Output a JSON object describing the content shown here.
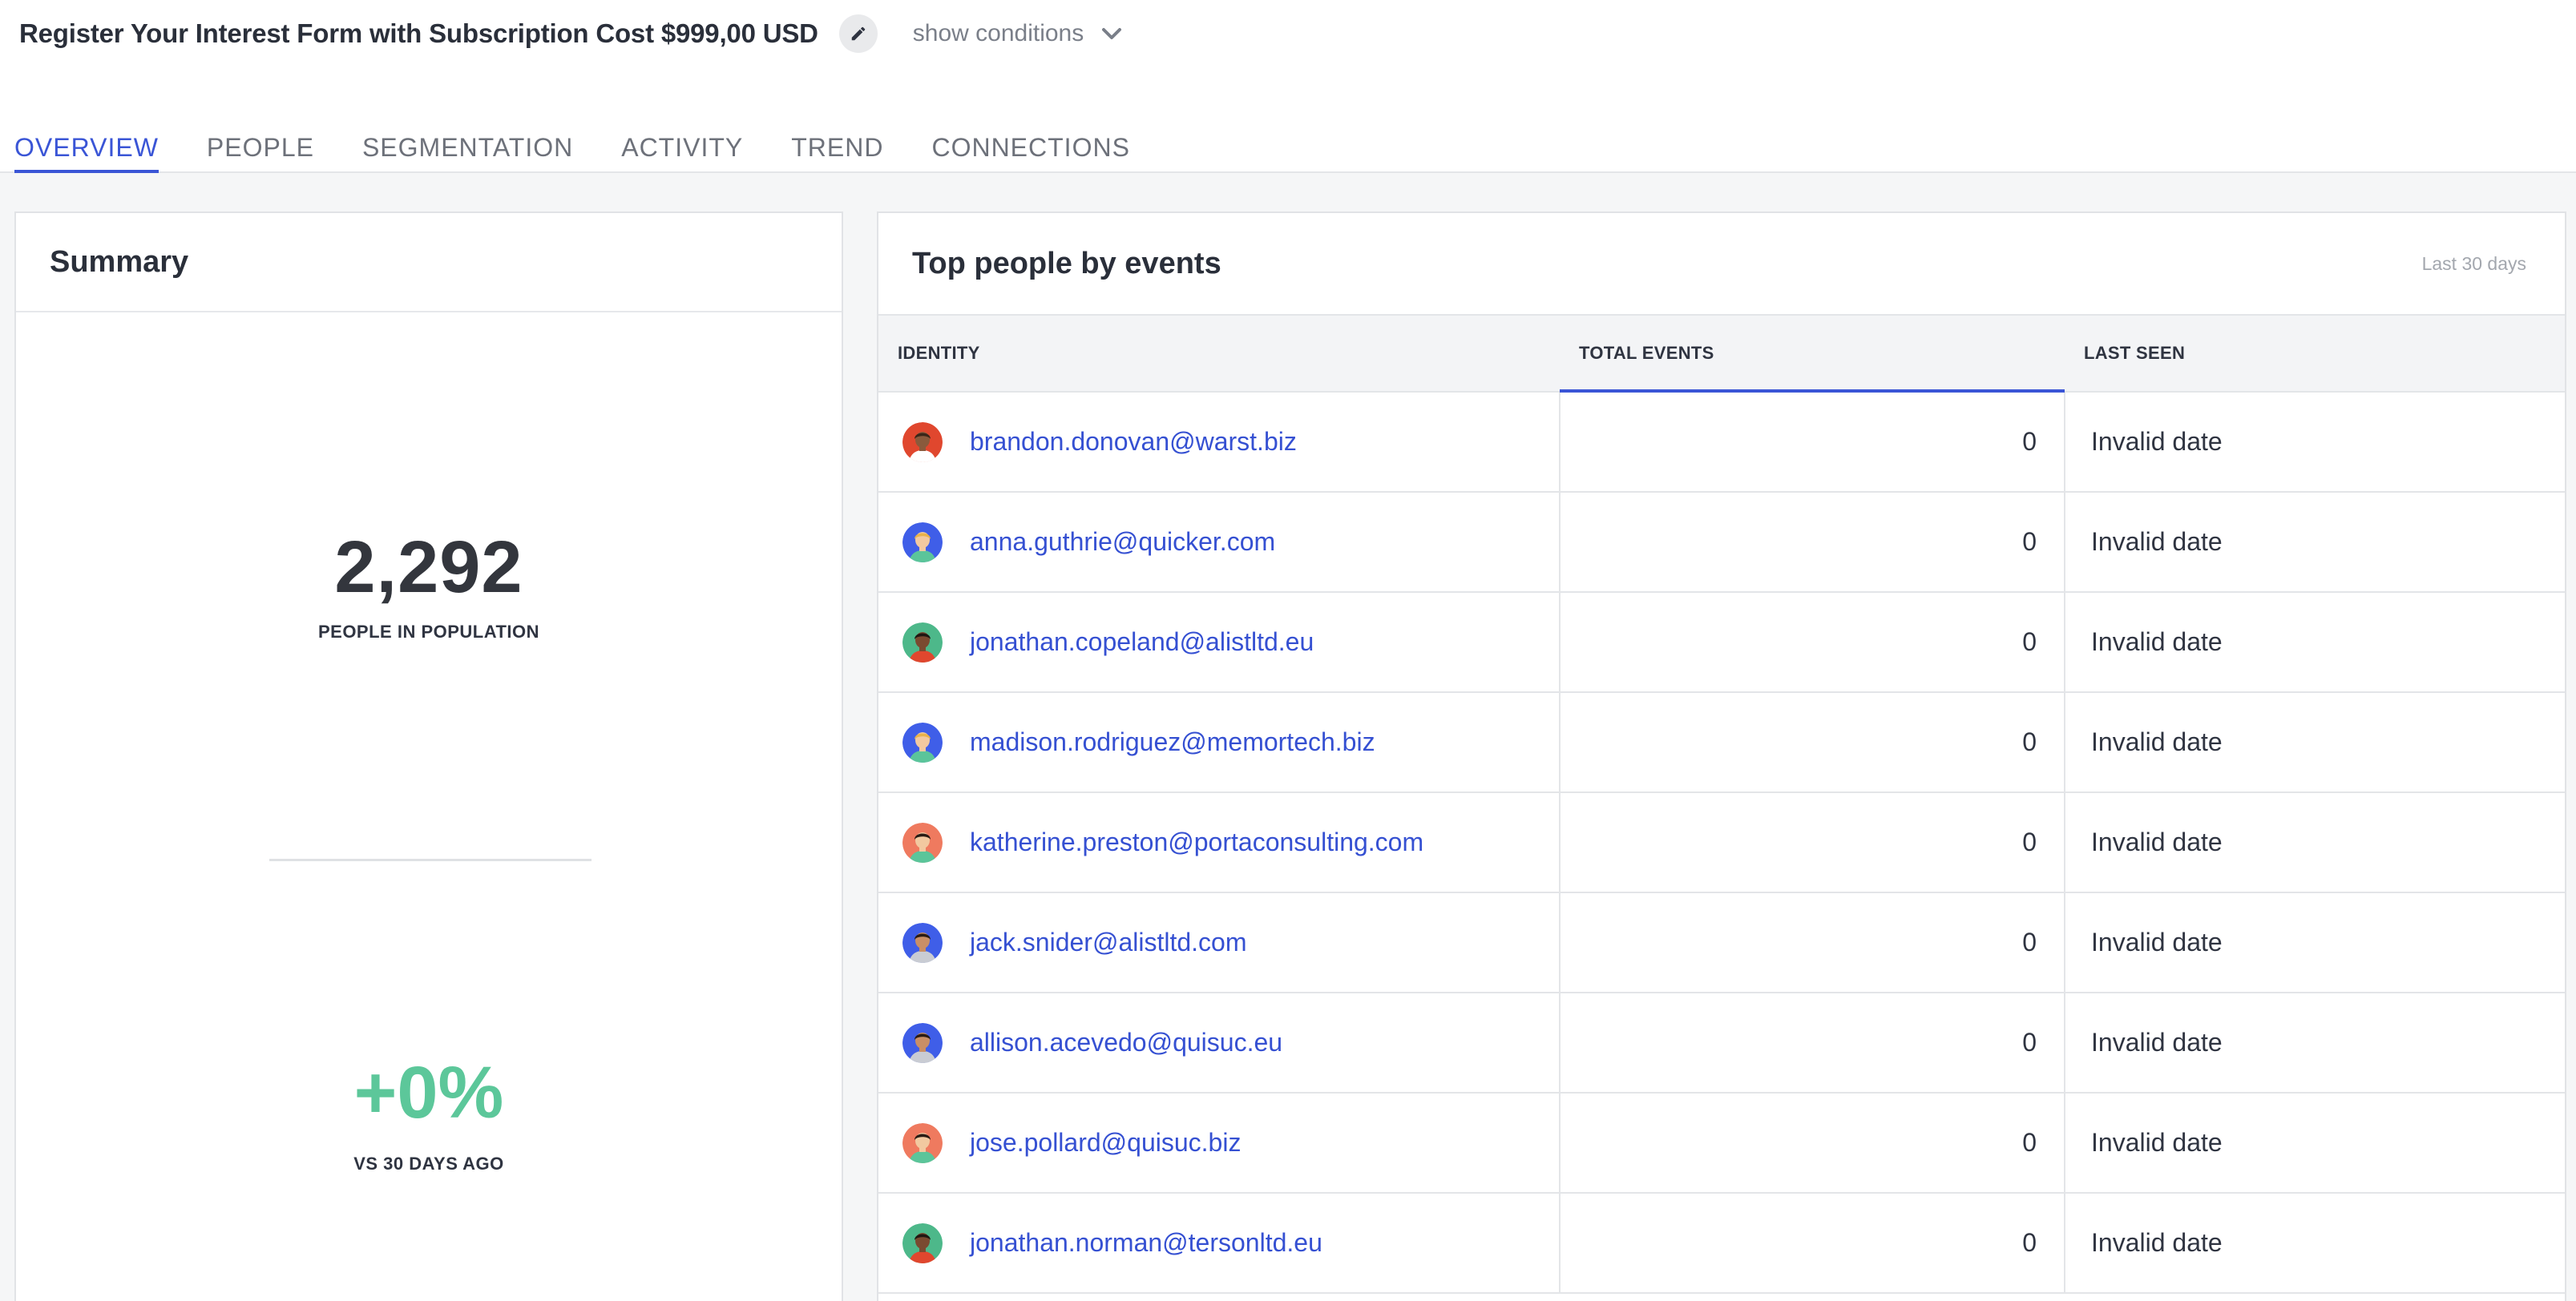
{
  "header": {
    "title": "Register Your Interest Form with Subscription Cost $999,00 USD",
    "show_conditions": "show conditions",
    "edit_icon": "pencil-icon",
    "conditions_icon": "chevron-down-icon"
  },
  "tabs": [
    {
      "label": "OVERVIEW",
      "active": true
    },
    {
      "label": "PEOPLE",
      "active": false
    },
    {
      "label": "SEGMENTATION",
      "active": false
    },
    {
      "label": "ACTIVITY",
      "active": false
    },
    {
      "label": "TREND",
      "active": false
    },
    {
      "label": "CONNECTIONS",
      "active": false
    }
  ],
  "summary": {
    "title": "Summary",
    "population": "2,292",
    "population_label": "PEOPLE IN POPULATION",
    "change": "+0%",
    "change_label": "VS 30 DAYS AGO"
  },
  "top_people": {
    "title": "Top people by events",
    "period": "Last 30 days",
    "columns": [
      "IDENTITY",
      "TOTAL EVENTS",
      "LAST SEEN"
    ],
    "sorted_column": "TOTAL EVENTS",
    "rows": [
      {
        "email": "brandon.donovan@warst.biz",
        "events": "0",
        "last_seen": "Invalid date",
        "avatar_bg": "#e0472e",
        "skin": "#8a5a3c",
        "hair": "#3b2618",
        "shirt": "#ffffff"
      },
      {
        "email": "anna.guthrie@quicker.com",
        "events": "0",
        "last_seen": "Invalid date",
        "avatar_bg": "#3f5ee8",
        "skin": "#f2c9a0",
        "hair": "#e8b24a",
        "shirt": "#5bc59a"
      },
      {
        "email": "jonathan.copeland@alistltd.eu",
        "events": "0",
        "last_seen": "Invalid date",
        "avatar_bg": "#4db88a",
        "skin": "#7a4a30",
        "hair": "#1f1712",
        "shirt": "#e0472e"
      },
      {
        "email": "madison.rodriguez@memortech.biz",
        "events": "0",
        "last_seen": "Invalid date",
        "avatar_bg": "#3f5ee8",
        "skin": "#f2c9a0",
        "hair": "#e8b24a",
        "shirt": "#5bc59a"
      },
      {
        "email": "katherine.preston@portaconsulting.com",
        "events": "0",
        "last_seen": "Invalid date",
        "avatar_bg": "#ef7a5f",
        "skin": "#f2c9a0",
        "hair": "#2a1c14",
        "shirt": "#5bc59a"
      },
      {
        "email": "jack.snider@alistltd.com",
        "events": "0",
        "last_seen": "Invalid date",
        "avatar_bg": "#3f5ee8",
        "skin": "#c98f66",
        "hair": "#2a1c14",
        "shirt": "#c9ccd3"
      },
      {
        "email": "allison.acevedo@quisuc.eu",
        "events": "0",
        "last_seen": "Invalid date",
        "avatar_bg": "#3f5ee8",
        "skin": "#c98f66",
        "hair": "#2a1c14",
        "shirt": "#c9ccd3"
      },
      {
        "email": "jose.pollard@quisuc.biz",
        "events": "0",
        "last_seen": "Invalid date",
        "avatar_bg": "#ef7a5f",
        "skin": "#f2c9a0",
        "hair": "#2a1c14",
        "shirt": "#5bc59a"
      },
      {
        "email": "jonathan.norman@tersonltd.eu",
        "events": "0",
        "last_seen": "Invalid date",
        "avatar_bg": "#4db88a",
        "skin": "#7a4a30",
        "hair": "#1f1712",
        "shirt": "#e0472e"
      }
    ]
  },
  "colors": {
    "accent": "#3a55d6",
    "link": "#3550d2",
    "positive": "#5cc79a"
  }
}
